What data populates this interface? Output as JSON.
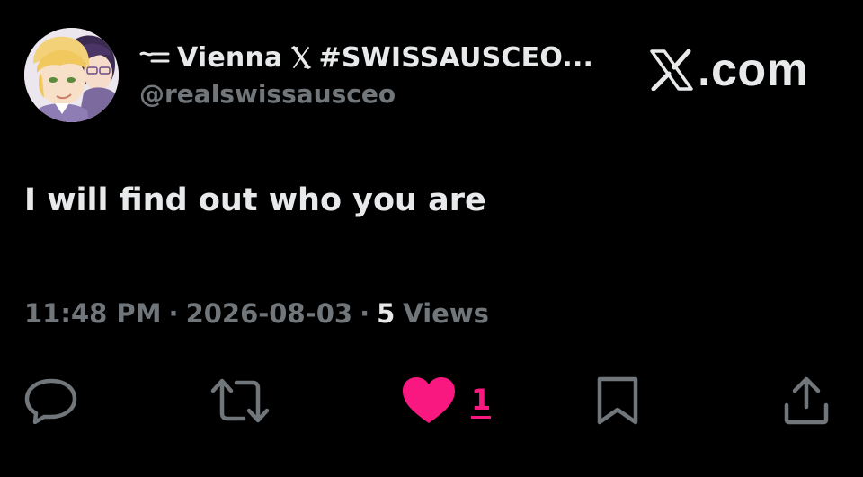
{
  "author": {
    "display_name": "Vienna",
    "hashtag": "#SWISSAUSCEO...",
    "handle": "@realswissausceo",
    "avatar_icon": "anime-character-avatar"
  },
  "brand": {
    "logo_icon": "x-logo-icon",
    "domain_text": ".com"
  },
  "tweet": {
    "text": "I will find out who you are"
  },
  "meta": {
    "time": "11:48 PM",
    "date": "2026-08-03",
    "separator": "·",
    "views_count": "5",
    "views_label": "Views"
  },
  "actions": {
    "reply_icon": "reply-icon",
    "repost_icon": "repost-icon",
    "like_icon": "heart-icon",
    "like_count": "1",
    "bookmark_icon": "bookmark-icon",
    "share_icon": "share-icon"
  },
  "colors": {
    "background": "#000000",
    "primary_text": "#e7e9ea",
    "secondary_text": "#71767b",
    "like_pink": "#f91880"
  }
}
